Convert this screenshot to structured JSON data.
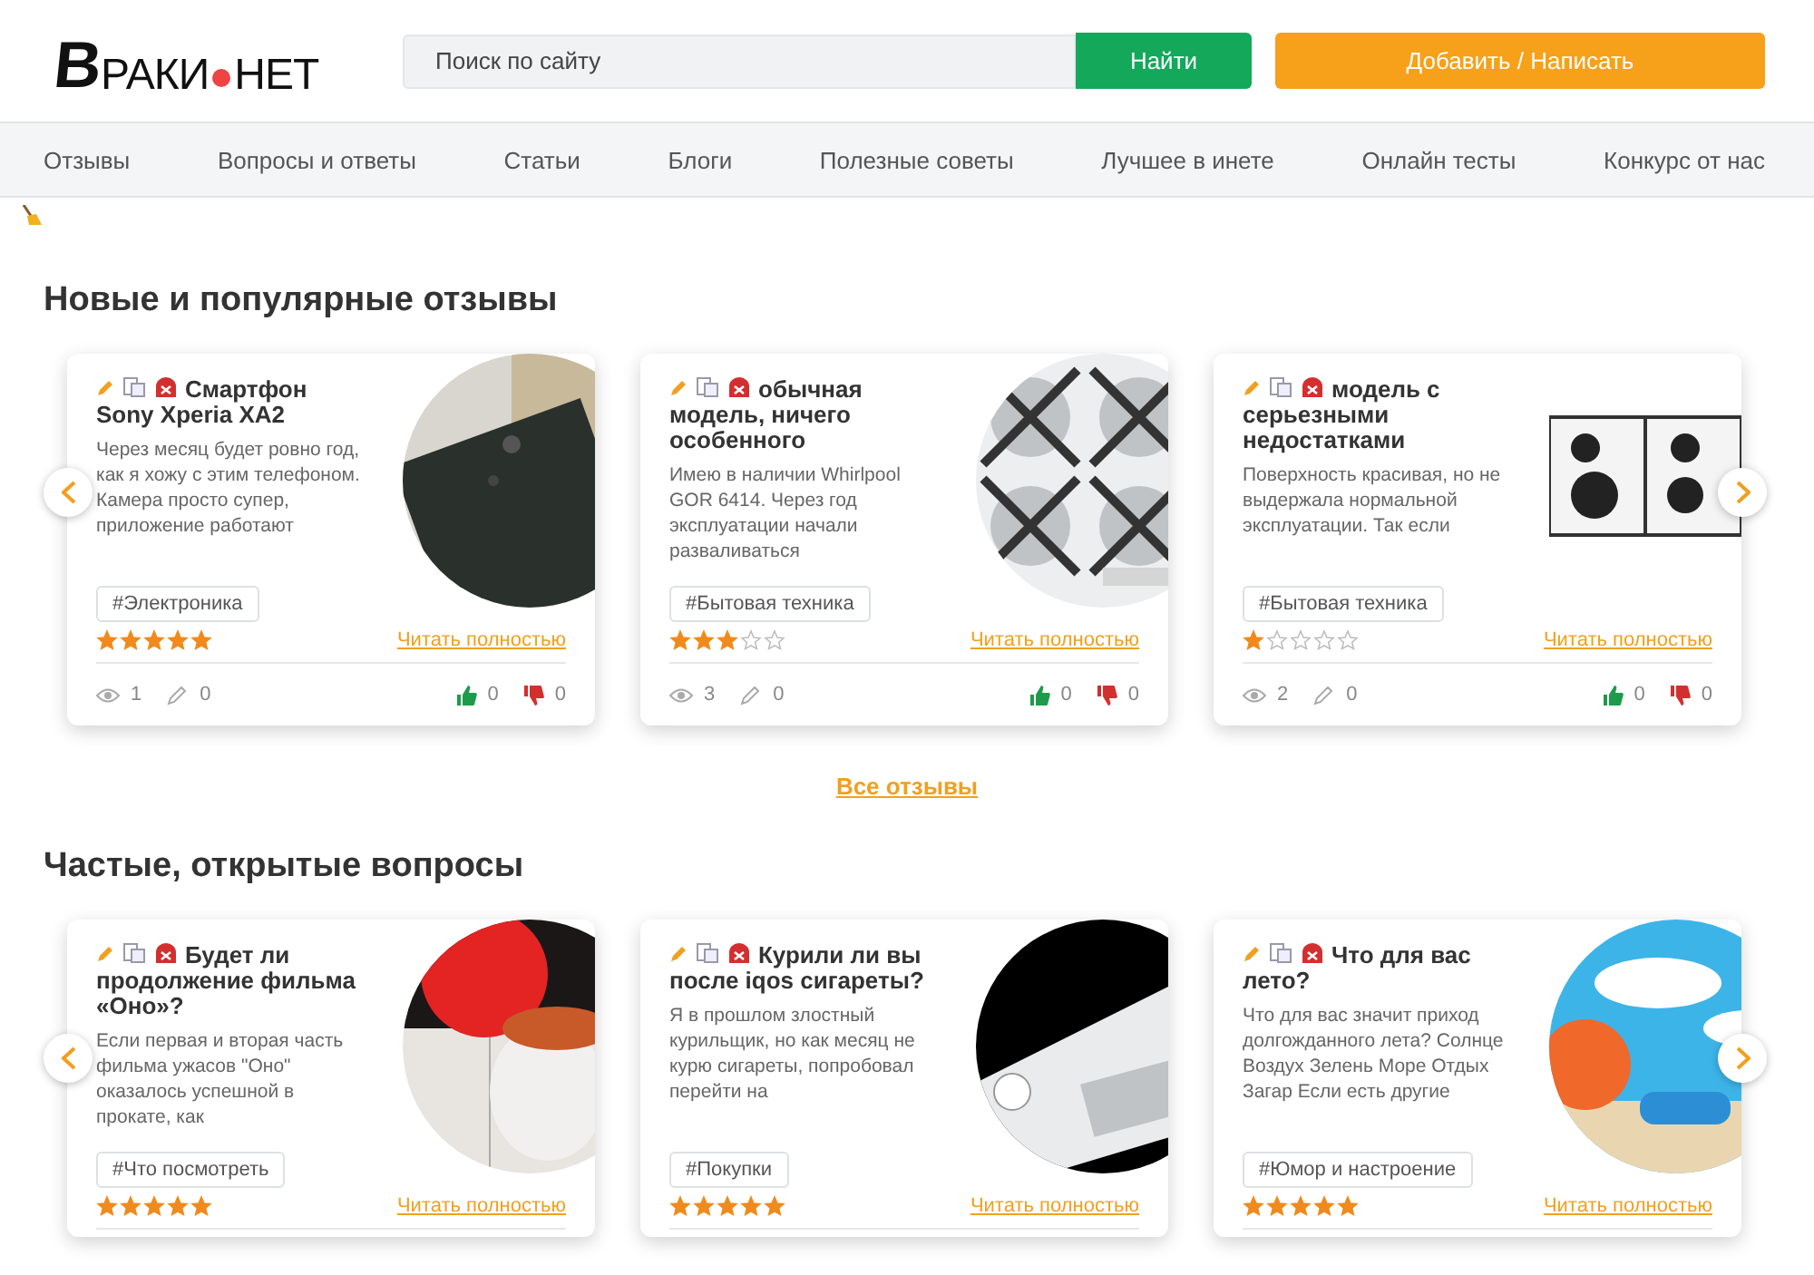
{
  "header": {
    "logo": {
      "first_letter": "В",
      "rest_left": "РАКИ",
      "rest_right": "НЕТ"
    },
    "search": {
      "placeholder": "Поиск по сайту"
    },
    "search_button": "Найти",
    "add_button": "Добавить / Написать"
  },
  "nav": [
    "Отзывы",
    "Вопросы и ответы",
    "Статьи",
    "Блоги",
    "Полезные советы",
    "Лучшее в инете",
    "Онлайн тесты",
    "Конкурс от нас"
  ],
  "sections": [
    {
      "title": "Новые и популярные отзывы",
      "cards": [
        {
          "title": "Смартфон Sony Xperia XA2",
          "text": "Через месяц будет ровно год, как я хожу с этим телефоном. Камера просто супер, приложение работают",
          "tag": "#Электроника",
          "stars": 5,
          "read_more": "Читать полностью",
          "views": "1",
          "comments": "0",
          "likes": "0",
          "dislikes": "0"
        },
        {
          "title": "обычная модель, ничего особенного",
          "text": "Имею в наличии Whirlpool GOR 6414. Через год эксплуатации начали разваливаться",
          "tag": "#Бытовая техника",
          "stars": 3,
          "read_more": "Читать полностью",
          "views": "3",
          "comments": "0",
          "likes": "0",
          "dislikes": "0"
        },
        {
          "title": "модель с серьезными недостатками",
          "text": "Поверхность красивая, но не выдержала нормальной эксплуатации. Так если",
          "tag": "#Бытовая техника",
          "stars": 1,
          "read_more": "Читать полностью",
          "views": "2",
          "comments": "0",
          "likes": "0",
          "dislikes": "0"
        }
      ],
      "all_link": "Все отзывы"
    },
    {
      "title": "Частые, открытые вопросы",
      "cards": [
        {
          "title": "Будет ли продолжение фильма «Оно»?",
          "text": "Если первая и вторая часть фильма ужасов \"Оно\" оказалось успешной в прокате, как",
          "tag": "#Что посмотреть",
          "stars": 5,
          "read_more": "Читать полностью"
        },
        {
          "title": "Курили ли вы после iqos сигареты?",
          "text": "Я в прошлом злостный курильщик, но как месяц не курю сигареты, попробовал перейти на",
          "tag": "#Покупки",
          "stars": 5,
          "read_more": "Читать полностью"
        },
        {
          "title": "Что для вас лето?",
          "text": "Что для вас значит приход долгожданного лета? Солнце Воздух Зелень Море Отдых Загар Если есть другие",
          "tag": "#Юмор и настроение",
          "stars": 5,
          "read_more": "Читать полностью"
        }
      ]
    }
  ]
}
